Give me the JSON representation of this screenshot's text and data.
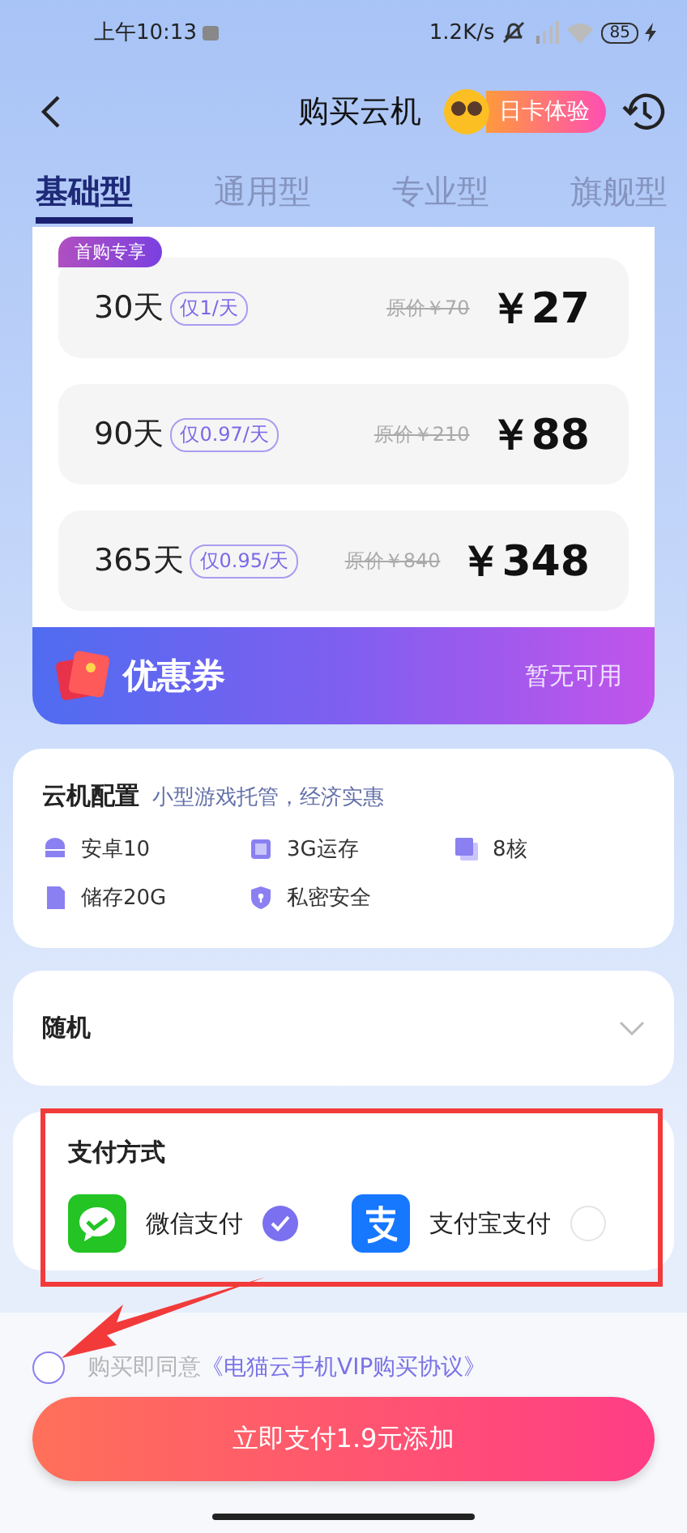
{
  "status_bar": {
    "time": "上午10:13",
    "speed": "1.2K/s",
    "battery": "85"
  },
  "header": {
    "title": "购买云机",
    "badge": "日卡体验"
  },
  "tabs": [
    {
      "label": "基础型",
      "selected": true
    },
    {
      "label": "通用型",
      "selected": false
    },
    {
      "label": "专业型",
      "selected": false
    },
    {
      "label": "旗舰型",
      "selected": false
    }
  ],
  "plans": [
    {
      "tag": "首购专享",
      "days": "30天",
      "per_day": "仅1/天",
      "original": "原价￥70",
      "price": "￥27"
    },
    {
      "days": "90天",
      "per_day": "仅0.97/天",
      "original": "原价￥210",
      "price": "￥88"
    },
    {
      "days": "365天",
      "per_day": "仅0.95/天",
      "original": "原价￥840",
      "price": "￥348"
    }
  ],
  "coupon": {
    "title": "优惠券",
    "status": "暂无可用"
  },
  "config": {
    "title": "云机配置",
    "subtitle": "小型游戏托管，经济实惠",
    "specs": [
      {
        "kind": "android",
        "label": "安卓10"
      },
      {
        "kind": "chip",
        "label": "3G运存"
      },
      {
        "kind": "cores",
        "label": "8核"
      },
      {
        "kind": "storage",
        "label": "储存20G"
      },
      {
        "kind": "shield",
        "label": "私密安全"
      }
    ]
  },
  "region": {
    "value": "随机"
  },
  "payment": {
    "title": "支付方式",
    "methods": [
      {
        "kind": "wechat",
        "label": "微信支付",
        "selected": true
      },
      {
        "kind": "alipay",
        "label": "支付宝支付",
        "selected": false
      }
    ]
  },
  "agreement": {
    "checked": false,
    "prefix": "购买即同意",
    "link": "《电猫云手机VIP购买协议》"
  },
  "pay_button": "立即支付1.9元添加"
}
